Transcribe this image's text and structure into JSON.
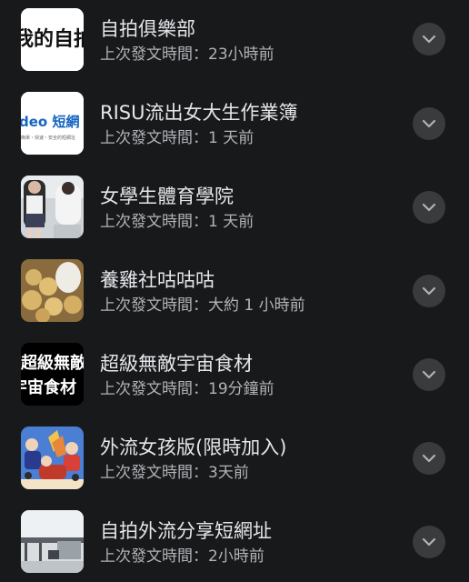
{
  "groups": [
    {
      "name": "自拍俱樂部",
      "last_post": "上次發文時間：23小時前",
      "thumb_text": "我的自拍"
    },
    {
      "name": "RISU流出女大生作業簿",
      "last_post": "上次發文時間：1 天前",
      "thumb_text": "deo 短網",
      "thumb_caption": "簡單・快速・安全的短網址"
    },
    {
      "name": "女學生體育學院",
      "last_post": "上次發文時間：1 天前"
    },
    {
      "name": "養雞社咕咕咕",
      "last_post": "上次發文時間：大約 1 小時前"
    },
    {
      "name": "超級無敵宇宙食材",
      "last_post": "上次發文時間：19分鐘前",
      "thumb_text_1": "超級無敵",
      "thumb_text_2": "宇宙食材"
    },
    {
      "name": "外流女孩版(限時加入)",
      "last_post": "上次發文時間：3天前"
    },
    {
      "name": "自拍外流分享短網址",
      "last_post": "上次發文時間：2小時前"
    }
  ],
  "colors": {
    "background": "#18191a",
    "title": "#e4e6eb",
    "subtitle": "#b0b3b8",
    "button": "#3a3b3c"
  },
  "icons": {
    "more_button": "chevron-down-icon"
  }
}
